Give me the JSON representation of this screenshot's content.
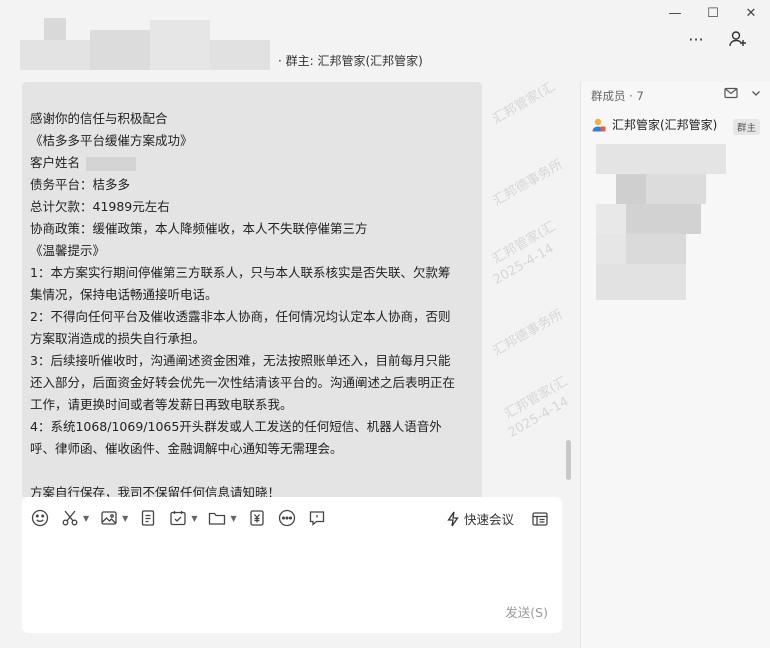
{
  "header": {
    "title": "· 群主: 汇邦管家(汇邦管家)",
    "more_label": "···"
  },
  "window": {
    "minimize": "—",
    "maximize": "☐",
    "close": "✕"
  },
  "message": {
    "lines": [
      "感谢你的信任与积极配合",
      "《桔多多平台缓催方案成功》",
      "客户姓名",
      "债务平台：桔多多",
      "总计欠款：41989元左右",
      "协商政策：缓催政策，本人降频催收，本人不失联停催第三方",
      "《温馨提示》",
      "1：本方案实行期间停催第三方联系人，只与本人联系核实是否失联、欠款筹",
      "集情况，保持电话畅通接听电话。",
      "2：不得向任何平台及催收透露非本人协商，任何情况均认定本人协商，否则",
      "方案取消造成的损失自行承担。",
      "3：后续接听催收时，沟通阐述资金困难，无法按照账单还入，目前每月只能",
      "还入部分，后面资金好转会优先一次性结清该平台的。沟通阐述之后表明正在",
      "工作，请更换时间或者等发薪日再致电联系我。",
      "4：系统1068/1069/1065开头群发或人工发送的任何短信、机器人语音外",
      "呼、律师函、催收函件、金融调解中心通知等无需理会。",
      "",
      "方案自行保存，我司不保留任何信息请知晓！"
    ]
  },
  "watermarks": [
    "汇邦管家(汇",
    "2025-4-14",
    "汇邦德事务所"
  ],
  "composer": {
    "quick_meeting": "快速会议",
    "send": "发送(S)"
  },
  "side": {
    "members_label": "群成员 · 7",
    "owner_name": "汇邦管家(汇邦管家)",
    "owner_badge": "群主"
  }
}
